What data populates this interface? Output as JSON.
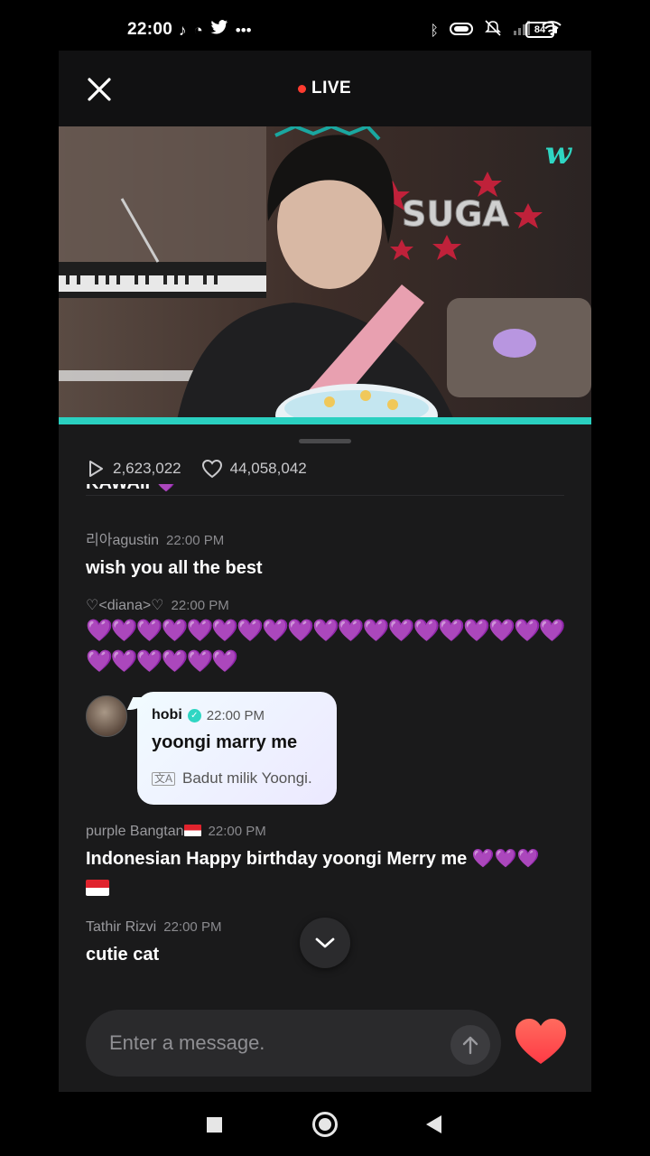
{
  "status_bar": {
    "time": "22:00",
    "left_icons": [
      "tiktok-icon",
      "chat-icon",
      "twitter-icon",
      "more-icon"
    ],
    "right_icons": [
      "bluetooth-icon",
      "toggle-icon",
      "mute-icon",
      "signal-icon",
      "wifi-icon"
    ],
    "battery": "84"
  },
  "header": {
    "live_label": "LIVE",
    "live_color": "#ff3b2f"
  },
  "video": {
    "overlay_text": "SUGA",
    "logo": "w",
    "progress_color": "#2ad0c0"
  },
  "stats": {
    "views": "2,623,022",
    "likes": "44,058,042"
  },
  "chat": {
    "cut_message": "KAWAII 💜",
    "messages": [
      {
        "user": "리아agustin",
        "time": "22:00 PM",
        "text": "wish you all the best"
      },
      {
        "user": "♡<diana>♡",
        "time": "22:00 PM",
        "hearts_line1": "💜💜💜💜💜💜💜💜💜💜💜💜💜💜💜💜💜💜💜",
        "hearts_line2": "💜💜💜💜💜💜"
      },
      {
        "user": "purple Bangtan",
        "time": "22:00 PM",
        "text": "Indonesian Happy birthday yoongi Merry me 💜💜💜"
      },
      {
        "user": "Tathir Rizvi",
        "time": "22:00 PM",
        "text": "cutie cat"
      }
    ],
    "artist": {
      "name": "hobi",
      "time": "22:00 PM",
      "text": "yoongi marry me",
      "translation": "Badut milik Yoongi."
    }
  },
  "input": {
    "placeholder": "Enter a message."
  },
  "colors": {
    "accent": "#2fd6c3",
    "heart": "#ff4d4d",
    "purple_heart": "#9a3fe0"
  }
}
